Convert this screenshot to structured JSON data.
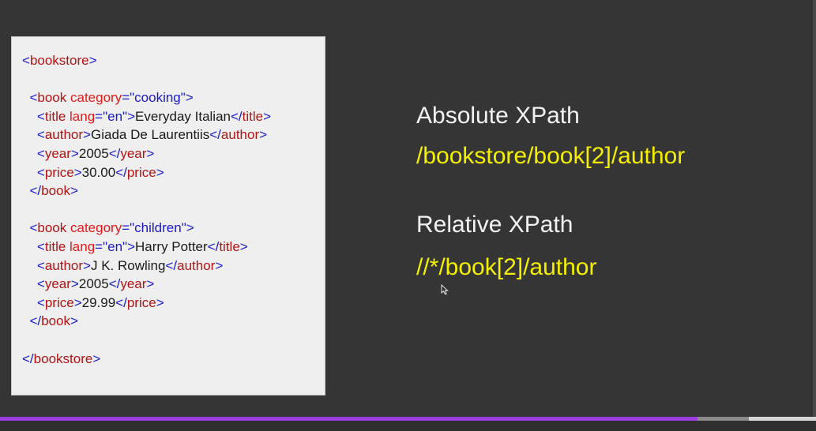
{
  "xml": {
    "lines": [
      [
        [
          "tag",
          "<"
        ],
        [
          "tname",
          "bookstore"
        ],
        [
          "tag",
          ">"
        ]
      ],
      [],
      [
        [
          "txt",
          "  "
        ],
        [
          "tag",
          "<"
        ],
        [
          "tname",
          "book "
        ],
        [
          "attr",
          "category"
        ],
        [
          "tag",
          "="
        ],
        [
          "aval",
          "\"cooking\""
        ],
        [
          "tag",
          ">"
        ]
      ],
      [
        [
          "txt",
          "    "
        ],
        [
          "tag",
          "<"
        ],
        [
          "tname",
          "title "
        ],
        [
          "attr",
          "lang"
        ],
        [
          "tag",
          "="
        ],
        [
          "aval",
          "\"en\""
        ],
        [
          "tag",
          ">"
        ],
        [
          "txt",
          "Everyday Italian"
        ],
        [
          "tag",
          "</"
        ],
        [
          "tname",
          "title"
        ],
        [
          "tag",
          ">"
        ]
      ],
      [
        [
          "txt",
          "    "
        ],
        [
          "tag",
          "<"
        ],
        [
          "tname",
          "author"
        ],
        [
          "tag",
          ">"
        ],
        [
          "txt",
          "Giada De Laurentiis"
        ],
        [
          "tag",
          "</"
        ],
        [
          "tname",
          "author"
        ],
        [
          "tag",
          ">"
        ]
      ],
      [
        [
          "txt",
          "    "
        ],
        [
          "tag",
          "<"
        ],
        [
          "tname",
          "year"
        ],
        [
          "tag",
          ">"
        ],
        [
          "txt",
          "2005"
        ],
        [
          "tag",
          "</"
        ],
        [
          "tname",
          "year"
        ],
        [
          "tag",
          ">"
        ]
      ],
      [
        [
          "txt",
          "    "
        ],
        [
          "tag",
          "<"
        ],
        [
          "tname",
          "price"
        ],
        [
          "tag",
          ">"
        ],
        [
          "txt",
          "30.00"
        ],
        [
          "tag",
          "</"
        ],
        [
          "tname",
          "price"
        ],
        [
          "tag",
          ">"
        ]
      ],
      [
        [
          "txt",
          "  "
        ],
        [
          "tag",
          "</"
        ],
        [
          "tname",
          "book"
        ],
        [
          "tag",
          ">"
        ]
      ],
      [],
      [
        [
          "txt",
          "  "
        ],
        [
          "tag",
          "<"
        ],
        [
          "tname",
          "book "
        ],
        [
          "attr",
          "category"
        ],
        [
          "tag",
          "="
        ],
        [
          "aval",
          "\"children\""
        ],
        [
          "tag",
          ">"
        ]
      ],
      [
        [
          "txt",
          "    "
        ],
        [
          "tag",
          "<"
        ],
        [
          "tname",
          "title "
        ],
        [
          "attr",
          "lang"
        ],
        [
          "tag",
          "="
        ],
        [
          "aval",
          "\"en\""
        ],
        [
          "tag",
          ">"
        ],
        [
          "txt",
          "Harry Potter"
        ],
        [
          "tag",
          "</"
        ],
        [
          "tname",
          "title"
        ],
        [
          "tag",
          ">"
        ]
      ],
      [
        [
          "txt",
          "    "
        ],
        [
          "tag",
          "<"
        ],
        [
          "tname",
          "author"
        ],
        [
          "tag",
          ">"
        ],
        [
          "txt",
          "J K. Rowling"
        ],
        [
          "tag",
          "</"
        ],
        [
          "tname",
          "author"
        ],
        [
          "tag",
          ">"
        ]
      ],
      [
        [
          "txt",
          "    "
        ],
        [
          "tag",
          "<"
        ],
        [
          "tname",
          "year"
        ],
        [
          "tag",
          ">"
        ],
        [
          "txt",
          "2005"
        ],
        [
          "tag",
          "</"
        ],
        [
          "tname",
          "year"
        ],
        [
          "tag",
          ">"
        ]
      ],
      [
        [
          "txt",
          "    "
        ],
        [
          "tag",
          "<"
        ],
        [
          "tname",
          "price"
        ],
        [
          "tag",
          ">"
        ],
        [
          "txt",
          "29.99"
        ],
        [
          "tag",
          "</"
        ],
        [
          "tname",
          "price"
        ],
        [
          "tag",
          ">"
        ]
      ],
      [
        [
          "txt",
          "  "
        ],
        [
          "tag",
          "</"
        ],
        [
          "tname",
          "book"
        ],
        [
          "tag",
          ">"
        ]
      ],
      [],
      [
        [
          "tag",
          "</"
        ],
        [
          "tname",
          "bookstore"
        ],
        [
          "tag",
          ">"
        ]
      ]
    ]
  },
  "absolute": {
    "heading": "Absolute XPath",
    "expression": "/bookstore/book[2]/author"
  },
  "relative": {
    "heading": "Relative XPath",
    "expression": "//*/book[2]/author"
  },
  "player": {
    "progress_fraction": 0.855,
    "buffered_fraction": 0.918
  },
  "colors": {
    "tag": "#1a1acc",
    "tag_name": "#b11414",
    "attribute": "#e31a1a",
    "attribute_value": "#1a1acc",
    "expression": "#f4f000",
    "progress": "#9b3fdc"
  },
  "icons": {
    "cursor": "mouse-pointer-icon"
  }
}
